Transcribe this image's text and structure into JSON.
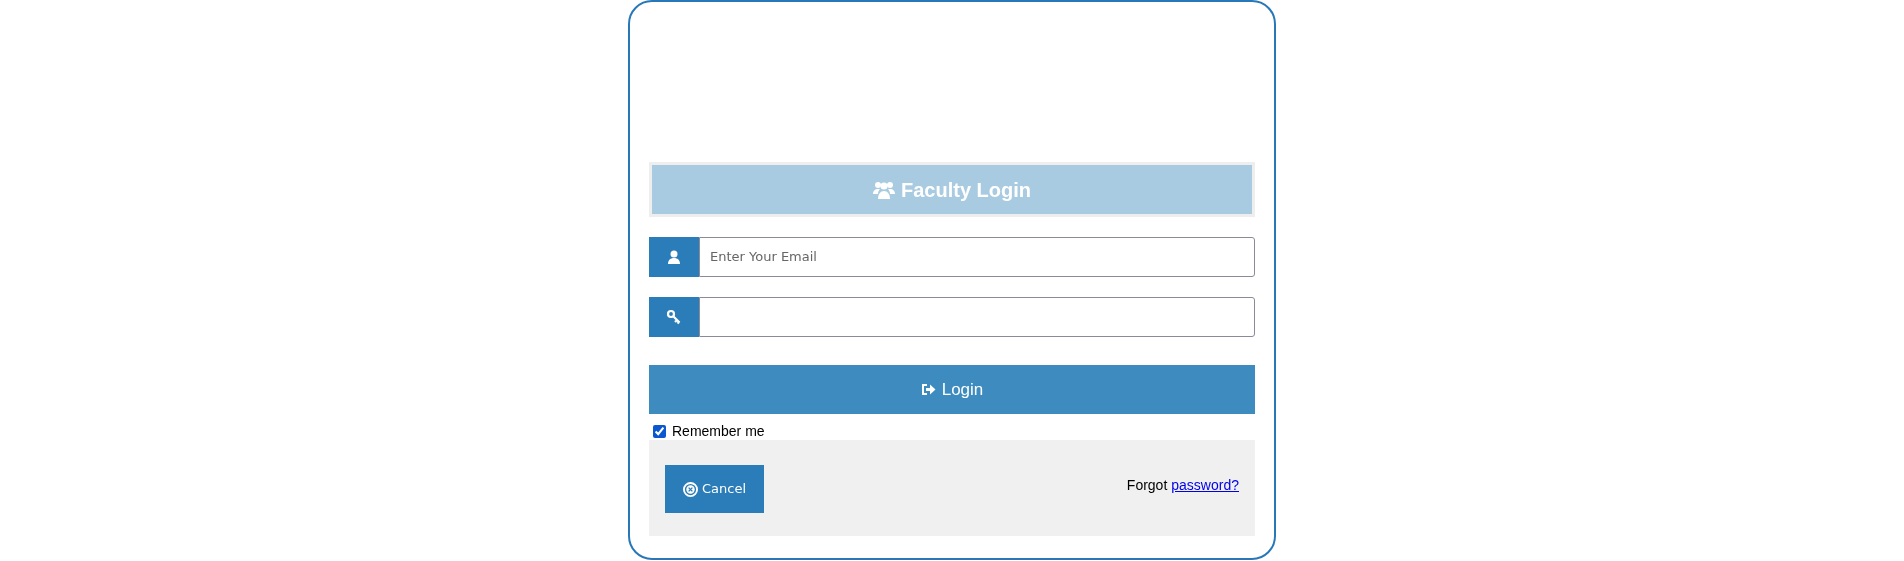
{
  "heading": "Faculty Login",
  "email_field": {
    "placeholder": "Enter Your Email"
  },
  "login_button": "Login",
  "remember_me": {
    "label": "Remember me",
    "checked": true
  },
  "cancel_button": "Cancel",
  "forgot": {
    "text": "Forgot",
    "link": "password?"
  }
}
